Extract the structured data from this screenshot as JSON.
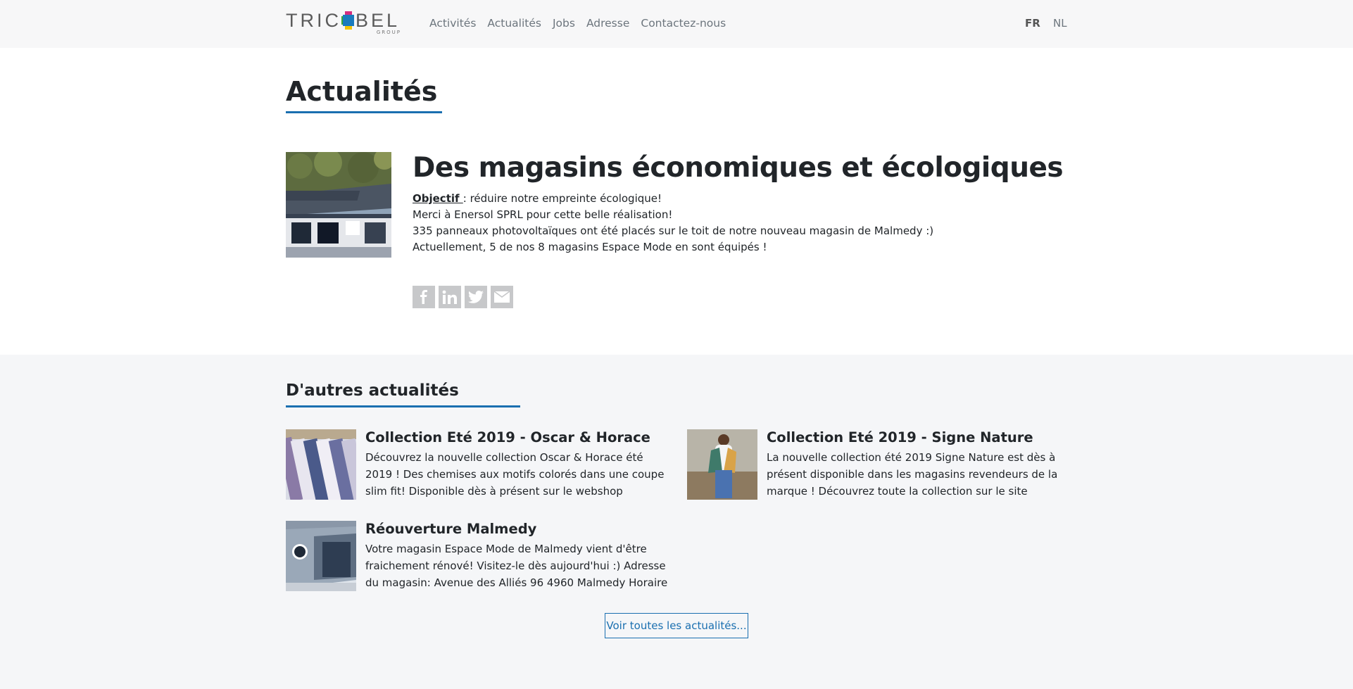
{
  "header": {
    "logo_text_left": "TRIC",
    "logo_text_right": "BEL",
    "logo_sub": "GROUP",
    "nav": [
      "Activités",
      "Actualités",
      "Jobs",
      "Adresse",
      "Contactez-nous"
    ],
    "lang_fr": "FR",
    "lang_nl": "NL"
  },
  "main": {
    "page_title": "Actualités",
    "featured": {
      "title": "Des magasins économiques et écologiques",
      "objective_label": "Objectif ",
      "objective_text": ": réduire notre empreinte écologique!",
      "lines": [
        "Merci à Enersol SPRL pour cette belle réalisation!",
        "335 panneaux photovoltaïques ont été placés sur le toit de notre nouveau magasin de Malmedy :)",
        "Actuellement, 5 de nos 8 magasins Espace Mode en sont équipés !"
      ],
      "share_icons": [
        "facebook-icon",
        "linkedin-icon",
        "twitter-icon",
        "mail-icon"
      ]
    }
  },
  "other": {
    "title": "D'autres actualités",
    "cards": [
      {
        "title": "Collection Eté 2019 - Oscar & Horace",
        "text": "Découvrez la nouvelle collection Oscar & Horace été 2019 ! Des chemises aux motifs colorés dans une coupe slim fit! Disponible dès à présent sur le webshop"
      },
      {
        "title": "Collection Eté 2019 - Signe Nature",
        "text": "La nouvelle collection été 2019 Signe Nature est dès à présent disponible dans les magasins revendeurs de la marque ! Découvrez toute la collection sur le site"
      },
      {
        "title": "Réouverture Malmedy",
        "text": "Votre magasin Espace Mode de Malmedy vient d'être fraichement rénové! Visitez-le dès aujourd'hui :) Adresse du magasin: Avenue des Alliés 96 4960 Malmedy Horaire"
      }
    ],
    "more_button": "Voir toutes les actualités..."
  }
}
